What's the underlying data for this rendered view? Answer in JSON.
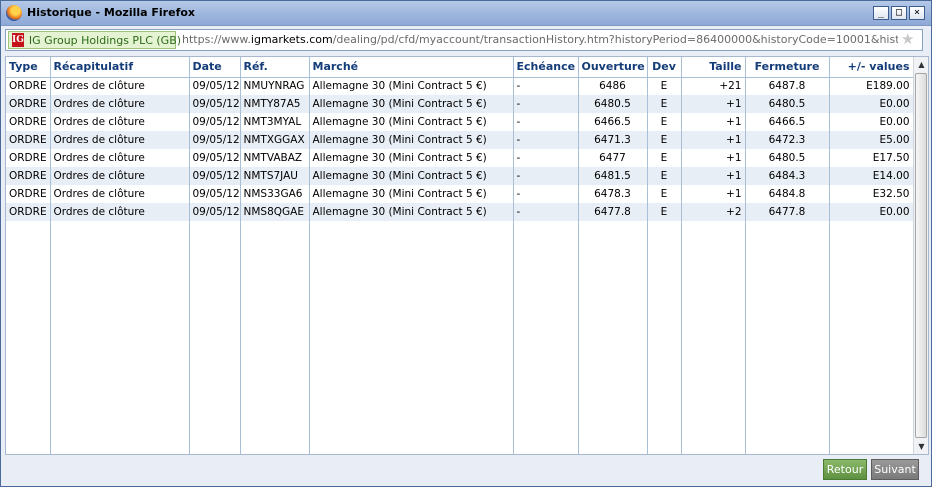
{
  "window": {
    "title": "Historique - Mozilla Firefox",
    "controls": [
      "_",
      "□",
      "×"
    ]
  },
  "address": {
    "site_identity": "IG Group Holdings PLC (GB)",
    "logo_text": "IG",
    "url_prefix": "https://www.",
    "url_host": "igmarkets.com",
    "url_path": "/dealing/pd/cfd/myaccount/transactionHistory.htm?historyPeriod=86400000&historyCode=10001&historyDateFrom=TOD"
  },
  "table": {
    "headers": [
      "Type",
      "Récapitulatif",
      "Date",
      "Réf.",
      "Marché",
      "Echéance",
      "Ouverture",
      "Dev",
      "Taille",
      "Fermeture",
      "+/- values"
    ],
    "rows": [
      [
        "ORDRE",
        "Ordres de clôture",
        "09/05/12",
        "NMUYNRAG",
        "Allemagne 30 (Mini Contract 5 €)",
        "-",
        "6486",
        "E",
        "+21",
        "6487.8",
        "E189.00"
      ],
      [
        "ORDRE",
        "Ordres de clôture",
        "09/05/12",
        "NMTY87A5",
        "Allemagne 30 (Mini Contract 5 €)",
        "-",
        "6480.5",
        "E",
        "+1",
        "6480.5",
        "E0.00"
      ],
      [
        "ORDRE",
        "Ordres de clôture",
        "09/05/12",
        "NMT3MYAL",
        "Allemagne 30 (Mini Contract 5 €)",
        "-",
        "6466.5",
        "E",
        "+1",
        "6466.5",
        "E0.00"
      ],
      [
        "ORDRE",
        "Ordres de clôture",
        "09/05/12",
        "NMTXGGAX",
        "Allemagne 30 (Mini Contract 5 €)",
        "-",
        "6471.3",
        "E",
        "+1",
        "6472.3",
        "E5.00"
      ],
      [
        "ORDRE",
        "Ordres de clôture",
        "09/05/12",
        "NMTVABAZ",
        "Allemagne 30 (Mini Contract 5 €)",
        "-",
        "6477",
        "E",
        "+1",
        "6480.5",
        "E17.50"
      ],
      [
        "ORDRE",
        "Ordres de clôture",
        "09/05/12",
        "NMTS7JAU",
        "Allemagne 30 (Mini Contract 5 €)",
        "-",
        "6481.5",
        "E",
        "+1",
        "6484.3",
        "E14.00"
      ],
      [
        "ORDRE",
        "Ordres de clôture",
        "09/05/12",
        "NMS33GA6",
        "Allemagne 30 (Mini Contract 5 €)",
        "-",
        "6478.3",
        "E",
        "+1",
        "6484.8",
        "E32.50"
      ],
      [
        "ORDRE",
        "Ordres de clôture",
        "09/05/12",
        "NMS8QGAE",
        "Allemagne 30 (Mini Contract 5 €)",
        "-",
        "6477.8",
        "E",
        "+2",
        "6477.8",
        "E0.00"
      ]
    ]
  },
  "footer": {
    "back_label": "Retour",
    "next_label": "Suivant"
  },
  "colors": {
    "header_text": "#133c78",
    "row_alt": "#e8eef6",
    "back_button": "#5d9140",
    "next_button": "#7a7a7a"
  },
  "icons": {
    "app": "firefox-icon",
    "bookmark": "star-icon",
    "scroll_up": "arrow-up-icon",
    "scroll_down": "arrow-down-icon"
  }
}
